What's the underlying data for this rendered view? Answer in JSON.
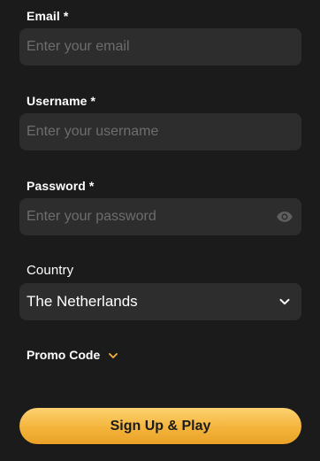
{
  "form": {
    "email": {
      "label": "Email *",
      "placeholder": "Enter your email"
    },
    "username": {
      "label": "Username *",
      "placeholder": "Enter your username"
    },
    "password": {
      "label": "Password *",
      "placeholder": "Enter your password",
      "icon": "eye-icon"
    },
    "country": {
      "label": "Country",
      "value": "The Netherlands",
      "icon": "chevron-down-icon"
    },
    "promo": {
      "label": "Promo Code",
      "icon": "chevron-down-icon"
    },
    "submit_label": "Sign Up & Play"
  },
  "colors": {
    "background": "#1b1b1b",
    "field": "#2d2d2d",
    "placeholder": "#6d6d6d",
    "accent": "#f4b43c"
  }
}
